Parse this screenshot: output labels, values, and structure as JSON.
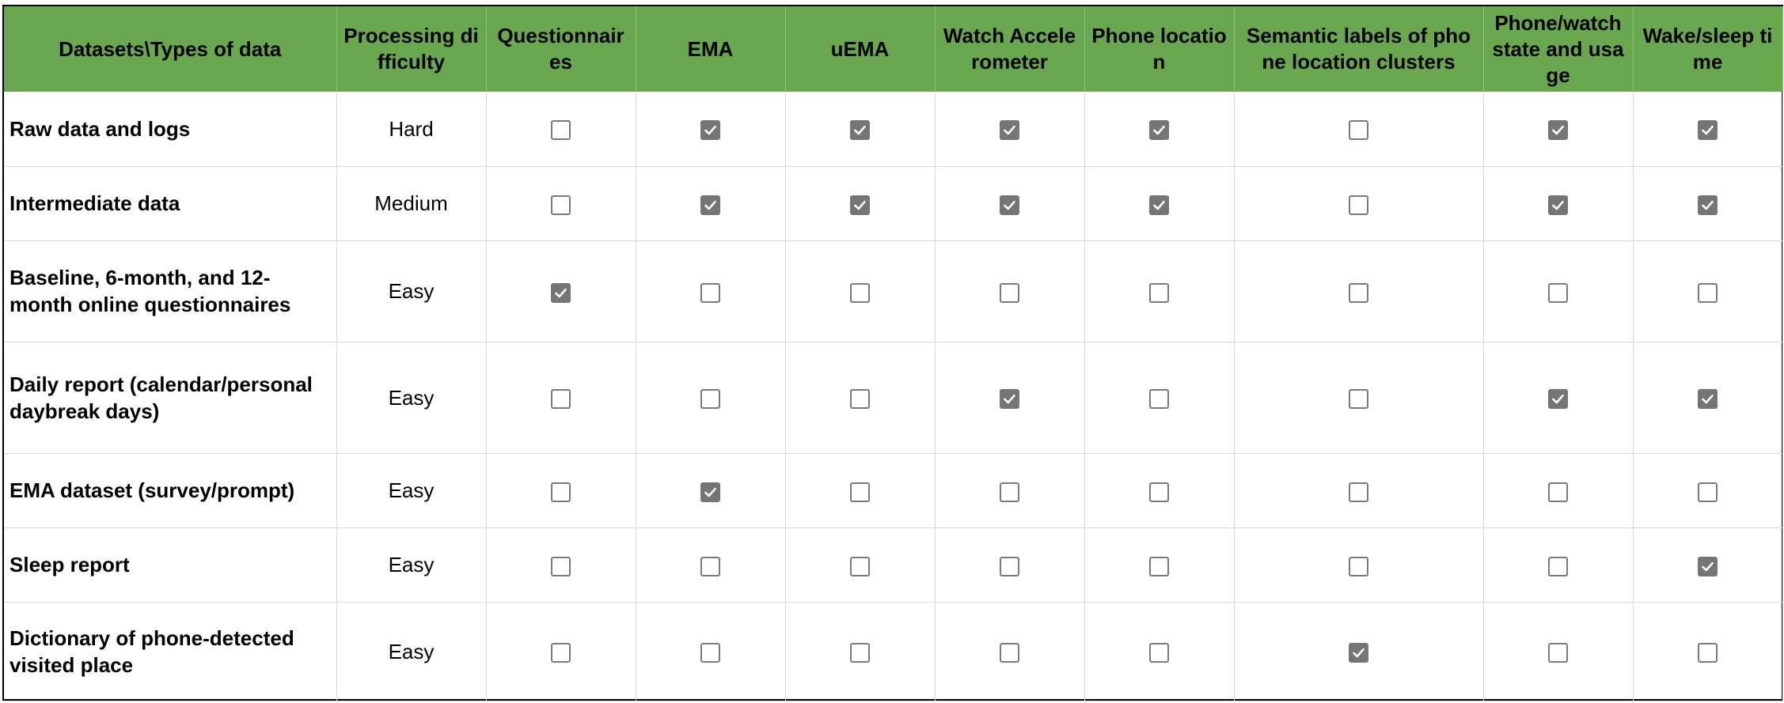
{
  "table": {
    "headers": [
      "Datasets\\Types of data",
      "Processing difficulty",
      "Questionnaires",
      "EMA",
      "uEMA",
      "Watch Accelerometer",
      "Phone location",
      "Semantic labels of phone location clusters",
      "Phone/watch state and usage",
      "Wake/sleep time"
    ],
    "rows": [
      {
        "label": "Raw data and logs",
        "difficulty": "Hard",
        "checks": [
          false,
          true,
          true,
          true,
          true,
          false,
          true,
          true
        ]
      },
      {
        "label": "Intermediate data",
        "difficulty": "Medium",
        "checks": [
          false,
          true,
          true,
          true,
          true,
          false,
          true,
          true
        ]
      },
      {
        "label": "Baseline, 6-month, and 12-month online questionnaires",
        "difficulty": "Easy",
        "checks": [
          true,
          false,
          false,
          false,
          false,
          false,
          false,
          false
        ]
      },
      {
        "label": "Daily report (calendar/personal daybreak days)",
        "difficulty": "Easy",
        "checks": [
          false,
          false,
          false,
          true,
          false,
          false,
          true,
          true
        ]
      },
      {
        "label": "EMA dataset (survey/prompt)",
        "difficulty": "Easy",
        "checks": [
          false,
          true,
          false,
          false,
          false,
          false,
          false,
          false
        ]
      },
      {
        "label": "Sleep report",
        "difficulty": "Easy",
        "checks": [
          false,
          false,
          false,
          false,
          false,
          false,
          false,
          true
        ]
      },
      {
        "label": "Dictionary of phone-detected visited place",
        "difficulty": "Easy",
        "checks": [
          false,
          false,
          false,
          false,
          false,
          true,
          false,
          false
        ]
      }
    ]
  },
  "colors": {
    "header_background": "#6aa84f",
    "checkbox_checked": "#757575",
    "checkbox_border": "#7a7a7a",
    "grid_line": "#d9d9d9"
  },
  "icons": {
    "checked": "checkbox-checked-icon",
    "unchecked": "checkbox-unchecked-icon"
  }
}
